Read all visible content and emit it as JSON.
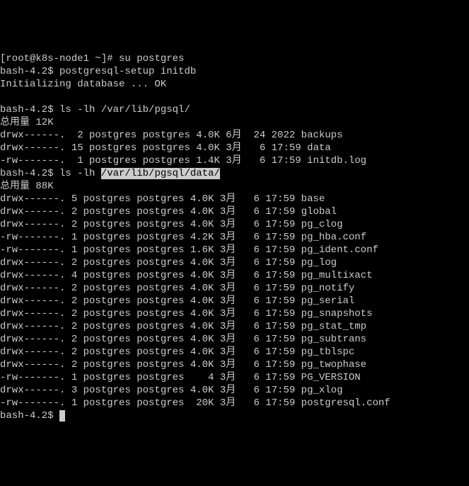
{
  "prompts": {
    "root": "[root@k8s-node1 ~]# ",
    "bash": "bash-4.2$ "
  },
  "cmds": {
    "su": "su postgres",
    "setup": "postgresql-setup initdb",
    "ls1": "ls -lh /var/lib/pgsql/",
    "ls2_a": "ls -lh ",
    "ls2_b": "/var/lib/pgsql/data/"
  },
  "msgs": {
    "init": "Initializing database ... OK",
    "total1": "总用量 12K",
    "total2": "总用量 88K"
  },
  "listing1": [
    "drwx------.  2 postgres postgres 4.0K 6月  24 2022 backups",
    "drwx------. 15 postgres postgres 4.0K 3月   6 17:59 data",
    "-rw-------.  1 postgres postgres 1.4K 3月   6 17:59 initdb.log"
  ],
  "listing2": [
    "drwx------. 5 postgres postgres 4.0K 3月   6 17:59 base",
    "drwx------. 2 postgres postgres 4.0K 3月   6 17:59 global",
    "drwx------. 2 postgres postgres 4.0K 3月   6 17:59 pg_clog",
    "-rw-------. 1 postgres postgres 4.2K 3月   6 17:59 pg_hba.conf",
    "-rw-------. 1 postgres postgres 1.6K 3月   6 17:59 pg_ident.conf",
    "drwx------. 2 postgres postgres 4.0K 3月   6 17:59 pg_log",
    "drwx------. 4 postgres postgres 4.0K 3月   6 17:59 pg_multixact",
    "drwx------. 2 postgres postgres 4.0K 3月   6 17:59 pg_notify",
    "drwx------. 2 postgres postgres 4.0K 3月   6 17:59 pg_serial",
    "drwx------. 2 postgres postgres 4.0K 3月   6 17:59 pg_snapshots",
    "drwx------. 2 postgres postgres 4.0K 3月   6 17:59 pg_stat_tmp",
    "drwx------. 2 postgres postgres 4.0K 3月   6 17:59 pg_subtrans",
    "drwx------. 2 postgres postgres 4.0K 3月   6 17:59 pg_tblspc",
    "drwx------. 2 postgres postgres 4.0K 3月   6 17:59 pg_twophase",
    "-rw-------. 1 postgres postgres    4 3月   6 17:59 PG_VERSION",
    "drwx------. 3 postgres postgres 4.0K 3月   6 17:59 pg_xlog",
    "-rw-------. 1 postgres postgres  20K 3月   6 17:59 postgresql.conf"
  ]
}
